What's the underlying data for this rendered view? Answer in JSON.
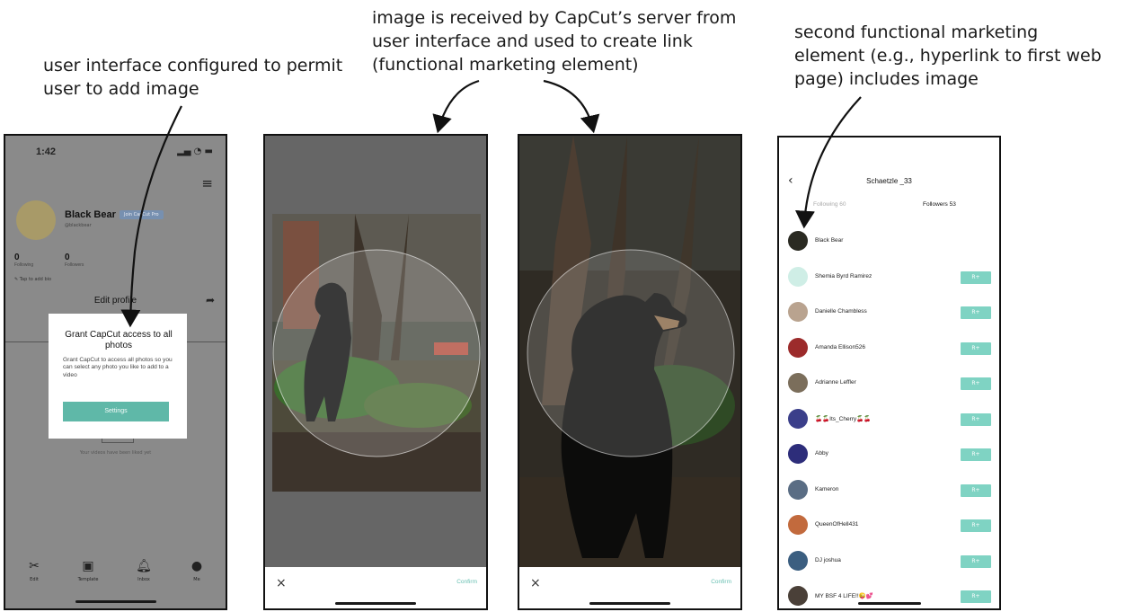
{
  "captions": {
    "c1": [
      "user interface configured to permit",
      "user to add image"
    ],
    "c2": [
      "image is received by CapCut’s server from",
      "user interface and used to create link",
      "(functional marketing element)"
    ],
    "c3": [
      "second functional marketing",
      "element (e.g., hyperlink to first web",
      "page) includes image"
    ]
  },
  "phone1": {
    "time": "1:42",
    "profile_name": "Black Bear",
    "badge": "Join CapCut Pro",
    "handle": "@blackbear",
    "stats": [
      {
        "value": "0",
        "label": "Following"
      },
      {
        "value": "0",
        "label": "Followers"
      }
    ],
    "bio": "Tap to add bio",
    "edit_profile": "Edit profile",
    "empty_text": "Your videos have been liked yet",
    "modal": {
      "title": "Grant CapCut access to all photos",
      "body": "Grant CapCut to access all photos so you can select any photo you like to add to a video",
      "button": "Settings"
    },
    "tabs": [
      {
        "icon": "scissors-icon",
        "label": "Edit"
      },
      {
        "icon": "template-icon",
        "label": "Template"
      },
      {
        "icon": "bell-icon",
        "label": "Inbox"
      },
      {
        "icon": "person-icon",
        "label": "Me"
      }
    ]
  },
  "crop": {
    "cancel": "×",
    "confirm": "Confirm"
  },
  "phone4": {
    "title": "Schaetzle _33",
    "following": "Following 60",
    "followers": "Followers 53",
    "users": [
      {
        "name": "Black Bear",
        "follow": false,
        "color": "#2a2a22"
      },
      {
        "name": "Shemia Byrd Ramirez",
        "follow": true,
        "color": "#cfeee6"
      },
      {
        "name": "Danielle Chambless",
        "follow": true,
        "color": "#b9a38f"
      },
      {
        "name": "Amanda Ellison526",
        "follow": true,
        "color": "#9c2b2b"
      },
      {
        "name": "Adrianne Leffler",
        "follow": true,
        "color": "#7b6e5b"
      },
      {
        "name": "🍒🍒Its_Cherry🍒🍒",
        "follow": true,
        "color": "#3b3f8a"
      },
      {
        "name": "Abby",
        "follow": true,
        "color": "#2d2d7a"
      },
      {
        "name": "Kameron",
        "follow": true,
        "color": "#5a6d84"
      },
      {
        "name": "QueenOfHell431",
        "follow": true,
        "color": "#c26a3d"
      },
      {
        "name": "DJ joshua",
        "follow": true,
        "color": "#3b5e80"
      },
      {
        "name": "MY BSF 4 LIFE!!😜💕",
        "follow": true,
        "color": "#4a4038"
      }
    ],
    "follow_label": "R+"
  }
}
